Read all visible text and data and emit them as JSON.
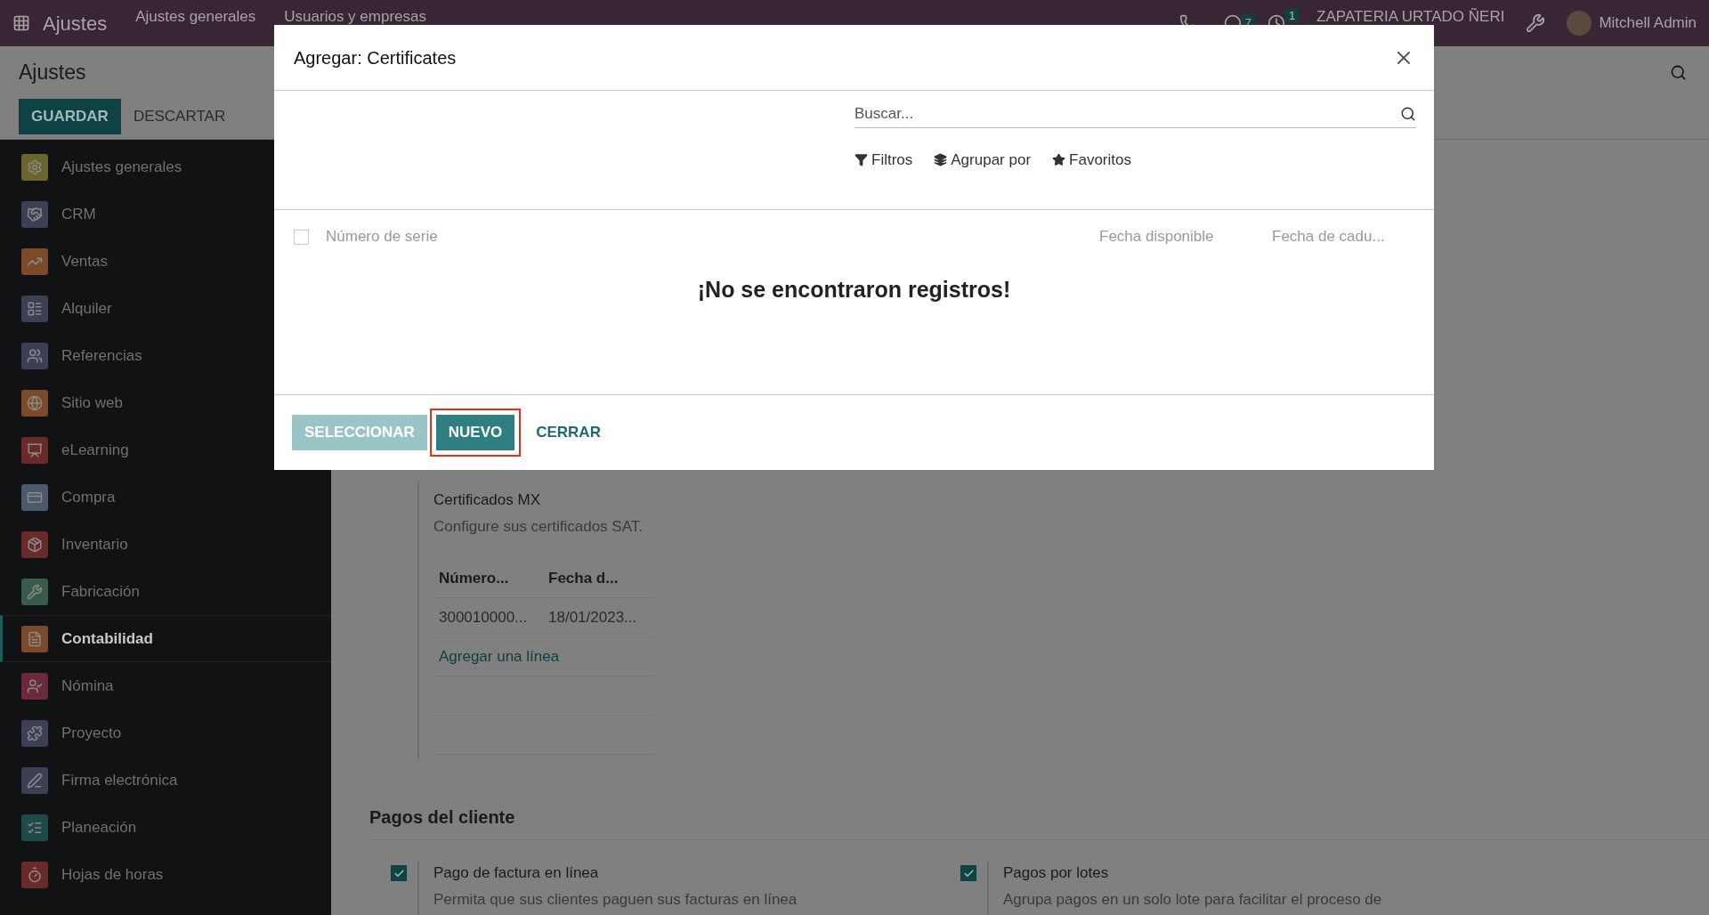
{
  "top_bar": {
    "app": "Ajustes",
    "menu": [
      "Ajustes generales",
      "Usuarios y empresas"
    ],
    "messages_count": "7",
    "activities_count": "1",
    "company": "ZAPATERIA URTADO ÑERI",
    "user": "Mitchell Admin"
  },
  "control_panel": {
    "title": "Ajustes",
    "save": "GUARDAR",
    "discard": "DESCARTAR"
  },
  "sidebar": {
    "items": [
      {
        "label": "Ajustes generales",
        "selected": false
      },
      {
        "label": "CRM",
        "selected": false
      },
      {
        "label": "Ventas",
        "selected": false
      },
      {
        "label": "Alquiler",
        "selected": false
      },
      {
        "label": "Referencias",
        "selected": false
      },
      {
        "label": "Sitio web",
        "selected": false
      },
      {
        "label": "eLearning",
        "selected": false
      },
      {
        "label": "Compra",
        "selected": false
      },
      {
        "label": "Inventario",
        "selected": false
      },
      {
        "label": "Fabricación",
        "selected": false
      },
      {
        "label": "Contabilidad",
        "selected": true
      },
      {
        "label": "Nómina",
        "selected": false
      },
      {
        "label": "Proyecto",
        "selected": false
      },
      {
        "label": "Firma electrónica",
        "selected": false
      },
      {
        "label": "Planeación",
        "selected": false
      },
      {
        "label": "Hojas de horas",
        "selected": false
      }
    ]
  },
  "certificates": {
    "title": "Certificados MX",
    "description": "Configure sus certificados SAT.",
    "columns": [
      "Número...",
      "Fecha d..."
    ],
    "rows": [
      [
        "300010000...",
        "18/01/2023..."
      ]
    ],
    "add_line": "Agregar una línea"
  },
  "customer_payments": {
    "heading": "Pagos del cliente",
    "settings": [
      {
        "title": "Pago de factura en línea",
        "description": "Permita que sus clientes paguen sus facturas en línea",
        "checked": true
      },
      {
        "title": "Pagos por lotes",
        "description": "Agrupa pagos en un solo lote para facilitar el proceso de",
        "checked": true
      }
    ]
  },
  "dialog": {
    "title": "Agregar: Certificates",
    "search": {
      "placeholder": "Buscar..."
    },
    "filters": [
      "Filtros",
      "Agrupar por",
      "Favoritos"
    ],
    "select_all": {
      "checked": false
    },
    "columns": [
      "Número de serie",
      "Fecha disponible",
      "Fecha de cadu..."
    ],
    "empty_message": "¡No se encontraron registros!",
    "buttons": [
      {
        "label": "SELECCIONAR",
        "kind": "primary",
        "disabled": true,
        "highlighted": false
      },
      {
        "label": "NUEVO",
        "kind": "primary",
        "disabled": false,
        "highlighted": true
      },
      {
        "label": "CERRAR",
        "kind": "link",
        "disabled": false,
        "highlighted": false
      }
    ]
  }
}
